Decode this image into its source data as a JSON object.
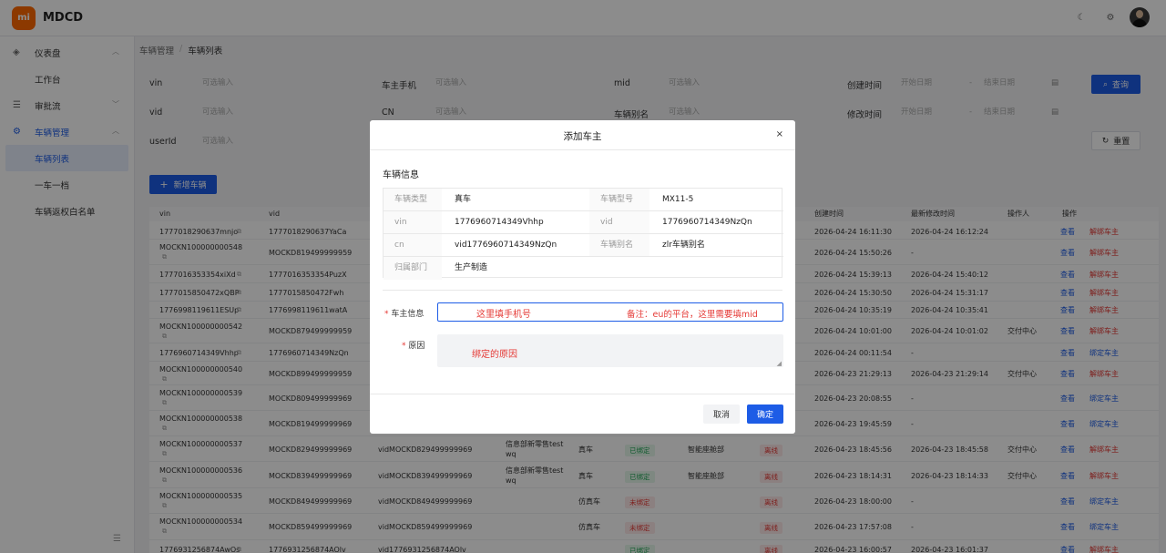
{
  "app": {
    "name": "MDCD",
    "logo_text": "mi"
  },
  "sidebar": {
    "items": [
      {
        "label": "仪表盘",
        "level": 1
      },
      {
        "label": "工作台",
        "level": 2
      },
      {
        "label": "审批流",
        "level": 1
      },
      {
        "label": "车辆管理",
        "level": 1
      },
      {
        "label": "车辆列表",
        "level": 2
      },
      {
        "label": "一车一档",
        "level": 2
      },
      {
        "label": "车辆返权白名单",
        "level": 2
      }
    ]
  },
  "breadcrumb": {
    "root": "车辆管理",
    "sep": "/",
    "current": "车辆列表"
  },
  "filters": {
    "vin": "vin",
    "vid": "vid",
    "userId": "userId",
    "owner_phone": "车主手机",
    "cn": "CN",
    "mid": "mid",
    "alias": "车辆别名",
    "create_time": "创建时间",
    "update_time": "修改时间",
    "placeholder": "可选输入",
    "start_date": "开始日期",
    "end_date": "结束日期",
    "dash": "-",
    "query": "查询",
    "reset": "重置"
  },
  "add_button": "新增车辆",
  "table": {
    "headers": {
      "vin": "vin",
      "vid": "vid",
      "create": "创建时间",
      "update": "最新修改时间",
      "operator": "操作人",
      "ops": "操作"
    },
    "view": "查看",
    "unbind": "解绑车主",
    "bind": "绑定车主",
    "rows": [
      {
        "vin": "1777018290637mnjo",
        "vid": "1777018290637YaCa",
        "create": "2026-04-24 16:11:30",
        "update": "2026-04-24 16:12:24",
        "op": "",
        "act": "解绑车主"
      },
      {
        "vin": "MOCKN100000000548",
        "vid": "MOCKD819499999959",
        "create": "2026-04-24 15:50:26",
        "update": "-",
        "op": "",
        "act": "解绑车主"
      },
      {
        "vin": "1777016353354xiXd",
        "vid": "1777016353354PuzX",
        "create": "2026-04-24 15:39:13",
        "update": "2026-04-24 15:40:12",
        "op": "",
        "act": "解绑车主"
      },
      {
        "vin": "1777015850472xQBP",
        "vid": "1777015850472Fwh",
        "create": "2026-04-24 15:30:50",
        "update": "2026-04-24 15:31:17",
        "op": "",
        "act": "解绑车主"
      },
      {
        "vin": "1776998119611ESUp",
        "vid": "1776998119611watA",
        "create": "2026-04-24 10:35:19",
        "update": "2026-04-24 10:35:41",
        "op": "",
        "act": "解绑车主"
      },
      {
        "vin": "MOCKN100000000542",
        "vid": "MOCKD879499999959",
        "create": "2026-04-24 10:01:00",
        "update": "2026-04-24 10:01:02",
        "op": "交付中心",
        "act": "解绑车主"
      },
      {
        "vin": "1776960714349Vhhp",
        "vid": "1776960714349NzQn",
        "create": "2026-04-24 00:11:54",
        "update": "-",
        "op": "",
        "act": "绑定车主"
      },
      {
        "vin": "MOCKN100000000540",
        "vid": "MOCKD899499999959",
        "create": "2026-04-23 21:29:13",
        "update": "2026-04-23 21:29:14",
        "op": "交付中心",
        "act": "解绑车主"
      },
      {
        "vin": "MOCKN100000000539",
        "vid": "MOCKD809499999969",
        "create": "2026-04-23 20:08:55",
        "update": "-",
        "op": "",
        "act": "绑定车主"
      },
      {
        "vin": "MOCKN100000000538",
        "vid": "MOCKD819499999969",
        "create": "2026-04-23 19:45:59",
        "update": "-",
        "op": "",
        "act": "绑定车主"
      },
      {
        "vin": "MOCKN100000000537",
        "vid": "MOCKD829499999969",
        "vid2": "vidMOCKD829499999969",
        "dept": "信息部新零售test wq",
        "type": "真车",
        "bind": "已绑定",
        "org": "智能座舱部",
        "online": "离线",
        "create": "2026-04-23 18:45:56",
        "update": "2026-04-23 18:45:58",
        "op": "交付中心",
        "act": "解绑车主"
      },
      {
        "vin": "MOCKN100000000536",
        "vid": "MOCKD839499999969",
        "vid2": "vidMOCKD839499999969",
        "dept": "信息部新零售test wq",
        "type": "真车",
        "bind": "已绑定",
        "org": "智能座舱部",
        "online": "离线",
        "create": "2026-04-23 18:14:31",
        "update": "2026-04-23 18:14:33",
        "op": "交付中心",
        "act": "解绑车主"
      },
      {
        "vin": "MOCKN100000000535",
        "vid": "MOCKD849499999969",
        "vid2": "vidMOCKD849499999969",
        "dept": "",
        "type": "仿真车",
        "bind": "未绑定",
        "org": "",
        "online": "离线",
        "create": "2026-04-23 18:00:00",
        "update": "-",
        "op": "",
        "act": "绑定车主"
      },
      {
        "vin": "MOCKN100000000534",
        "vid": "MOCKD859499999969",
        "vid2": "vidMOCKD859499999969",
        "dept": "",
        "type": "仿真车",
        "bind": "未绑定",
        "org": "",
        "online": "离线",
        "create": "2026-04-23 17:57:08",
        "update": "-",
        "op": "",
        "act": "绑定车主"
      },
      {
        "vin": "1776931256874AwOs",
        "vid": "1776931256874AOlv",
        "vid2": "vid1776931256874AOlv",
        "dept": "",
        "type": "",
        "bind": "已绑定",
        "org": "",
        "online": "离线",
        "create": "2026-04-23 16:00:57",
        "update": "2026-04-23 16:01:37",
        "op": "",
        "act": "解绑车主"
      }
    ]
  },
  "modal": {
    "title": "添加车主",
    "close": "×",
    "section": "车辆信息",
    "info": {
      "type_label": "车辆类型",
      "type_value": "真车",
      "model_label": "车辆型号",
      "model_value": "MX11-5",
      "vin_label": "vin",
      "vin_value": "1776960714349Vhhp",
      "vid_label": "vid",
      "vid_value": "1776960714349NzQn",
      "cn_label": "cn",
      "cn_value": "vid1776960714349NzQn",
      "alias_label": "车辆别名",
      "alias_value": "zlr车辆别名",
      "dept_label": "归属部门",
      "dept_value": "生产制造"
    },
    "owner_label": "车主信息",
    "reason_label": "原因",
    "required_mark": "*",
    "cancel": "取消",
    "confirm": "确定"
  },
  "annotations": {
    "owner_hint": "这里填手机号",
    "owner_note": "备注：eu的平台，这里需要填mid",
    "reason_hint": "绑定的原因"
  }
}
